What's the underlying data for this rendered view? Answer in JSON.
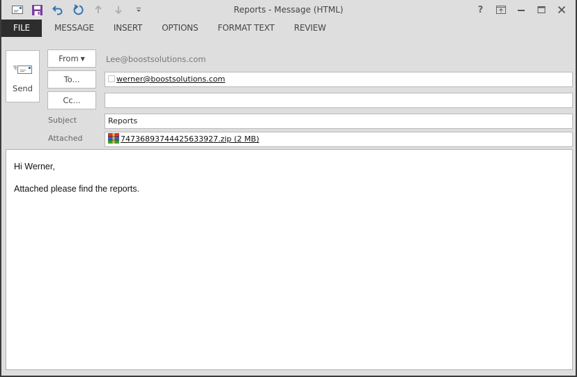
{
  "window": {
    "title": "Reports - Message (HTML)"
  },
  "quick_access": [
    {
      "name": "message-icon",
      "tooltip": "Message"
    },
    {
      "name": "save-icon",
      "tooltip": "Save"
    },
    {
      "name": "undo-icon",
      "tooltip": "Undo"
    },
    {
      "name": "redo-icon",
      "tooltip": "Redo"
    },
    {
      "name": "up-arrow-icon",
      "tooltip": "Previous Item"
    },
    {
      "name": "down-arrow-icon",
      "tooltip": "Next Item"
    },
    {
      "name": "customize-qat-icon",
      "tooltip": "Customize Quick Access Toolbar"
    }
  ],
  "window_controls": {
    "help": "?",
    "ribbon_display": "ribbon-display-icon",
    "minimize": "minimize-icon",
    "maximize": "maximize-icon",
    "close": "close-icon"
  },
  "tabs": [
    {
      "label": "FILE"
    },
    {
      "label": "MESSAGE"
    },
    {
      "label": "INSERT"
    },
    {
      "label": "OPTIONS"
    },
    {
      "label": "FORMAT TEXT"
    },
    {
      "label": "REVIEW"
    }
  ],
  "compose": {
    "send_label": "Send",
    "from_label": "From",
    "from_value": "Lee@boostsolutions.com",
    "to_label": "To...",
    "to_value": "werner@boostsolutions.com",
    "cc_label": "Cc...",
    "cc_value": "",
    "subject_label": "Subject",
    "subject_value": "Reports",
    "attached_label": "Attached",
    "attachment": "747368937444256339​27.zip (2 MB)"
  },
  "body": {
    "lines": [
      "Hi Werner,",
      "Attached please find the reports."
    ]
  },
  "colors": {
    "file_tab_bg": "#2d2d2d",
    "chrome_bg": "#dedede",
    "accent_blue": "#2e75b6",
    "save_purple": "#7b3e9b"
  }
}
